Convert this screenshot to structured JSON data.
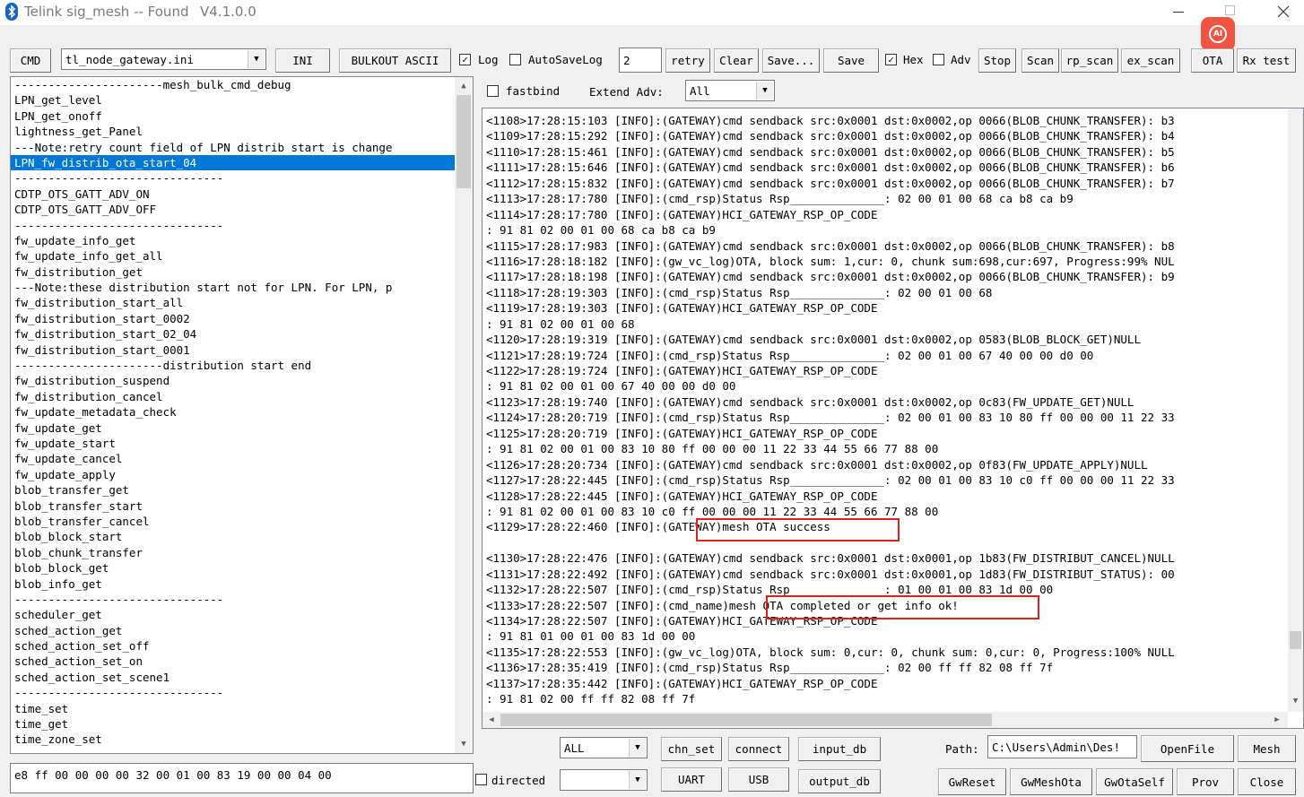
{
  "window": {
    "title": "Telink sig_mesh -- Found",
    "version": "V4.1.0.0",
    "ai_badge": "AI"
  },
  "toolbar": {
    "cmd_label": "CMD",
    "ini_file": "tl_node_gateway.ini",
    "ini_label": "INI",
    "bulkout_label": "BULKOUT ASCII",
    "log_label": "Log",
    "log_checked": true,
    "autosavelog_label": "AutoSaveLog",
    "autosavelog_checked": false,
    "retry_value": "2",
    "retry_label": "retry",
    "clear_label": "Clear",
    "save_dots_label": "Save...",
    "save_label": "Save",
    "hex_label": "Hex",
    "hex_checked": true,
    "adv_label": "Adv",
    "adv_checked": false,
    "stop_label": "Stop",
    "scan_label": "Scan",
    "rp_scan_label": "rp_scan",
    "ex_scan_label": "ex_scan",
    "ota_label": "OTA",
    "rx_test_label": "Rx test"
  },
  "options": {
    "fastbind_label": "fastbind",
    "extend_adv_label": "Extend Adv:",
    "extend_adv_value": "All"
  },
  "cmd_list": {
    "selected_index": 5,
    "items": [
      "----------------------mesh_bulk_cmd_debug",
      "LPN_get_level",
      "LPN_get_onoff",
      "lightness_get_Panel",
      "---Note:retry count field of LPN distrib start is change",
      "LPN_fw_distrib_ota_start_04",
      "-------------------------------",
      "CDTP_OTS_GATT_ADV_ON",
      "CDTP_OTS_GATT_ADV_OFF",
      "-------------------------------",
      "fw_update_info_get",
      "fw_update_info_get_all",
      "fw_distribution_get",
      "---Note:these distribution start not for LPN. For LPN, p",
      "fw_distribution_start_all",
      "fw_distribution_start_0002",
      "fw_distribution_start_02_04",
      "fw_distribution_start_0001",
      "----------------------distribution start end",
      "fw_distribution_suspend",
      "fw_distribution_cancel",
      "fw_update_metadata_check",
      "fw_update_get",
      "fw_update_start",
      "fw_update_cancel",
      "fw_update_apply",
      "blob_transfer_get",
      "blob_transfer_start",
      "blob_transfer_cancel",
      "blob_block_start",
      "blob_chunk_transfer",
      "blob_block_get",
      "blob_info_get",
      "-------------------------------",
      "scheduler_get",
      "sched_action_get",
      "sched_action_set_off",
      "sched_action_set_on",
      "sched_action_set_scene1",
      "-------------------------------",
      "time_set",
      "time_get",
      "time_zone_set"
    ]
  },
  "hex_input": {
    "value": "e8 ff 00 00 00 00 32 00 01 00 83 19 00 00 04 00"
  },
  "directed": {
    "label": "directed",
    "checked": false,
    "value": ""
  },
  "log": {
    "lines": [
      "<1108>17:28:15:103 [INFO]:(GATEWAY)cmd sendback src:0x0001 dst:0x0002,op 0066(BLOB_CHUNK_TRANSFER): b3",
      "<1109>17:28:15:292 [INFO]:(GATEWAY)cmd sendback src:0x0001 dst:0x0002,op 0066(BLOB_CHUNK_TRANSFER): b4",
      "<1110>17:28:15:461 [INFO]:(GATEWAY)cmd sendback src:0x0001 dst:0x0002,op 0066(BLOB_CHUNK_TRANSFER): b5",
      "<1111>17:28:15:646 [INFO]:(GATEWAY)cmd sendback src:0x0001 dst:0x0002,op 0066(BLOB_CHUNK_TRANSFER): b6",
      "<1112>17:28:15:832 [INFO]:(GATEWAY)cmd sendback src:0x0001 dst:0x0002,op 0066(BLOB_CHUNK_TRANSFER): b7",
      "<1113>17:28:17:780 [INFO]:(cmd_rsp)Status Rsp______________: 02 00 01 00 68 ca b8 ca b9",
      "<1114>17:28:17:780 [INFO]:(GATEWAY)HCI_GATEWAY_RSP_OP_CODE",
      ": 91 81 02 00 01 00 68 ca b8 ca b9",
      "<1115>17:28:17:983 [INFO]:(GATEWAY)cmd sendback src:0x0001 dst:0x0002,op 0066(BLOB_CHUNK_TRANSFER): b8",
      "<1116>17:28:18:182 [INFO]:(gw_vc_log)OTA, block sum: 1,cur: 0, chunk sum:698,cur:697, Progress:99% NUL",
      "<1117>17:28:18:198 [INFO]:(GATEWAY)cmd sendback src:0x0001 dst:0x0002,op 0066(BLOB_CHUNK_TRANSFER): b9",
      "<1118>17:28:19:303 [INFO]:(cmd_rsp)Status Rsp______________: 02 00 01 00 68",
      "<1119>17:28:19:303 [INFO]:(GATEWAY)HCI_GATEWAY_RSP_OP_CODE",
      ": 91 81 02 00 01 00 68",
      "<1120>17:28:19:319 [INFO]:(GATEWAY)cmd sendback src:0x0001 dst:0x0002,op 0583(BLOB_BLOCK_GET)NULL",
      "<1121>17:28:19:724 [INFO]:(cmd_rsp)Status Rsp______________: 02 00 01 00 67 40 00 00 d0 00",
      "<1122>17:28:19:724 [INFO]:(GATEWAY)HCI_GATEWAY_RSP_OP_CODE",
      ": 91 81 02 00 01 00 67 40 00 00 d0 00",
      "<1123>17:28:19:740 [INFO]:(GATEWAY)cmd sendback src:0x0001 dst:0x0002,op 0c83(FW_UPDATE_GET)NULL",
      "<1124>17:28:20:719 [INFO]:(cmd_rsp)Status Rsp______________: 02 00 01 00 83 10 80 ff 00 00 00 11 22 33",
      "<1125>17:28:20:719 [INFO]:(GATEWAY)HCI_GATEWAY_RSP_OP_CODE",
      ": 91 81 02 00 01 00 83 10 80 ff 00 00 00 11 22 33 44 55 66 77 88 00",
      "<1126>17:28:20:734 [INFO]:(GATEWAY)cmd sendback src:0x0001 dst:0x0002,op 0f83(FW_UPDATE_APPLY)NULL",
      "<1127>17:28:22:445 [INFO]:(cmd_rsp)Status Rsp______________: 02 00 01 00 83 10 c0 ff 00 00 00 11 22 33",
      "<1128>17:28:22:445 [INFO]:(GATEWAY)HCI_GATEWAY_RSP_OP_CODE",
      ": 91 81 02 00 01 00 83 10 c0 ff 00 00 00 11 22 33 44 55 66 77 88 00",
      "<1129>17:28:22:460 [INFO]:(GATEWAY)mesh OTA success",
      "",
      "<1130>17:28:22:476 [INFO]:(GATEWAY)cmd sendback src:0x0001 dst:0x0001,op 1b83(FW_DISTRIBUT_CANCEL)NULL",
      "<1131>17:28:22:492 [INFO]:(GATEWAY)cmd sendback src:0x0001 dst:0x0001,op 1d83(FW_DISTRIBUT_STATUS): 00",
      "<1132>17:28:22:507 [INFO]:(cmd_rsp)Status Rsp______________: 01 00 01 00 83 1d 00 00",
      "<1133>17:28:22:507 [INFO]:(cmd_name)mesh OTA completed or get info ok!",
      "<1134>17:28:22:507 [INFO]:(GATEWAY)HCI_GATEWAY_RSP_OP_CODE",
      ": 91 81 01 00 01 00 83 1d 00 00",
      "<1135>17:28:22:553 [INFO]:(gw_vc_log)OTA, block sum: 0,cur: 0, chunk sum: 0,cur: 0, Progress:100% NULL",
      "<1136>17:28:35:419 [INFO]:(cmd_rsp)Status Rsp______________: 02 00 ff ff 82 08 ff 7f",
      "<1137>17:28:35:442 [INFO]:(GATEWAY)HCI_GATEWAY_RSP_OP_CODE",
      ": 91 81 02 00 ff ff 82 08 ff 7f"
    ]
  },
  "bottom": {
    "all_value": "ALL",
    "chn_set_label": "chn_set",
    "connect_label": "connect",
    "input_db_label": "input_db",
    "uart_label": "UART",
    "usb_label": "USB",
    "output_db_label": "output_db",
    "path_label": "Path:",
    "path_value": "C:\\Users\\Admin\\Des!",
    "openfile_label": "OpenFile",
    "mesh_label": "Mesh",
    "gwreset_label": "GwReset",
    "gwmeshota_label": "GwMeshOta",
    "gwotaself_label": "GwOtaSelf",
    "prov_label": "Prov",
    "close_label": "Close"
  },
  "colors": {
    "selection": "#0078d7",
    "highlight_box": "#e0201b",
    "ai_badge": "#f0533f"
  }
}
